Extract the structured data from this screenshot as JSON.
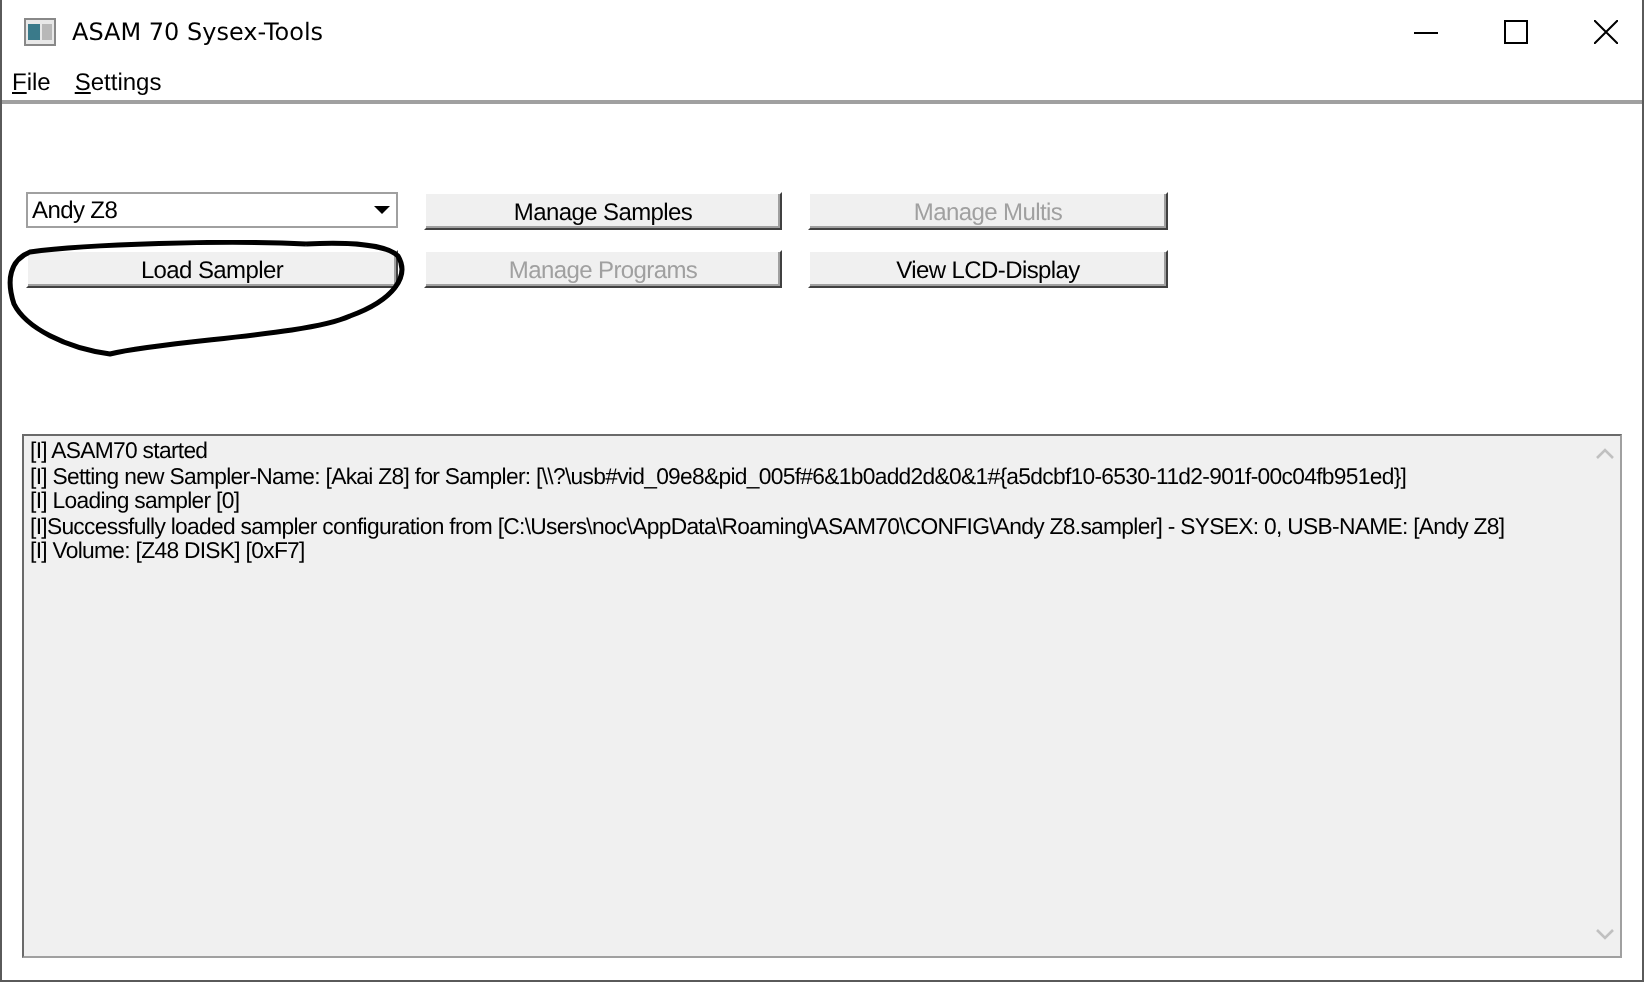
{
  "window": {
    "title": "ASAM 70 Sysex-Tools"
  },
  "menu": [
    {
      "label": "File"
    },
    {
      "label": "Settings"
    }
  ],
  "sampler_select": {
    "value": "Andy Z8"
  },
  "buttons": [
    {
      "label": "Manage Samples",
      "disabled": false
    },
    {
      "label": "Manage Multis",
      "disabled": true
    },
    {
      "label": "Load Sampler",
      "disabled": false
    },
    {
      "label": "Manage Programs",
      "disabled": true
    },
    {
      "label": "View LCD-Display",
      "disabled": false
    }
  ],
  "log": [
    "[I] ASAM70 started",
    "[I] Setting new Sampler-Name: [Akai Z8] for Sampler: [\\\\?\\usb#vid_09e8&pid_005f#6&1b0add2d&0&1#{a5dcbf10-6530-11d2-901f-00c04fb951ed}]",
    "[I] Loading sampler [0]",
    "[I]Successfully loaded sampler configuration from [C:\\Users\\noc\\AppData\\Roaming\\ASAM70\\CONFIG\\Andy Z8.sampler] - SYSEX: 0, USB-NAME: [Andy Z8]",
    "[I] Volume: [Z48 DISK] [0xF7]"
  ]
}
